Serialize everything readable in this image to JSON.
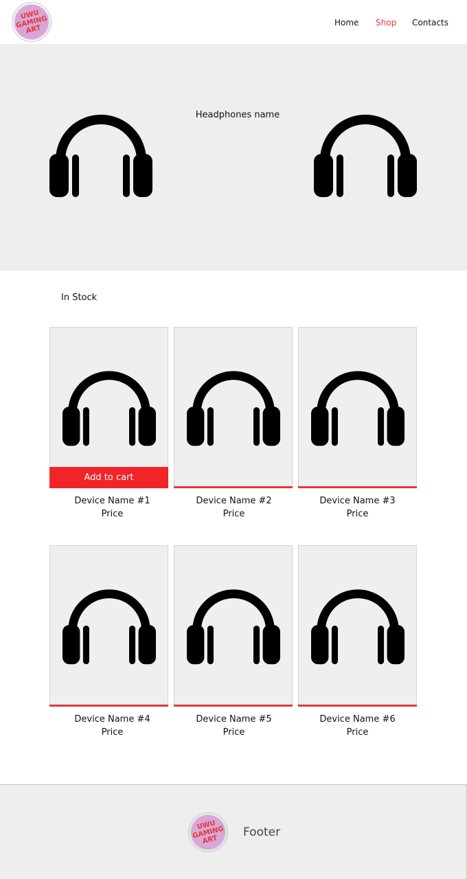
{
  "header": {
    "logo_text": "UWU\nGAMING\nART",
    "nav": [
      {
        "label": "Home",
        "active": false
      },
      {
        "label": "Shop",
        "active": true
      },
      {
        "label": "Contacts",
        "active": false
      }
    ]
  },
  "hero": {
    "title": "Headphones name",
    "icon": "headphones-icon"
  },
  "stock": {
    "label": "In Stock"
  },
  "products": [
    {
      "name": "Device Name #1",
      "price": "Price",
      "cart_label": "Add to cart"
    },
    {
      "name": "Device Name #2",
      "price": "Price"
    },
    {
      "name": "Device Name #3",
      "price": "Price"
    },
    {
      "name": "Device Name #4",
      "price": "Price"
    },
    {
      "name": "Device Name #5",
      "price": "Price"
    },
    {
      "name": "Device Name #6",
      "price": "Price"
    }
  ],
  "footer": {
    "logo_text": "UWU\nGAMING\nART",
    "label": "Footer"
  },
  "colors": {
    "accent": "#e2383a",
    "cart_button": "#f22427",
    "panel_bg": "#eeeeee",
    "logo_disc": "#d9a6d6"
  }
}
